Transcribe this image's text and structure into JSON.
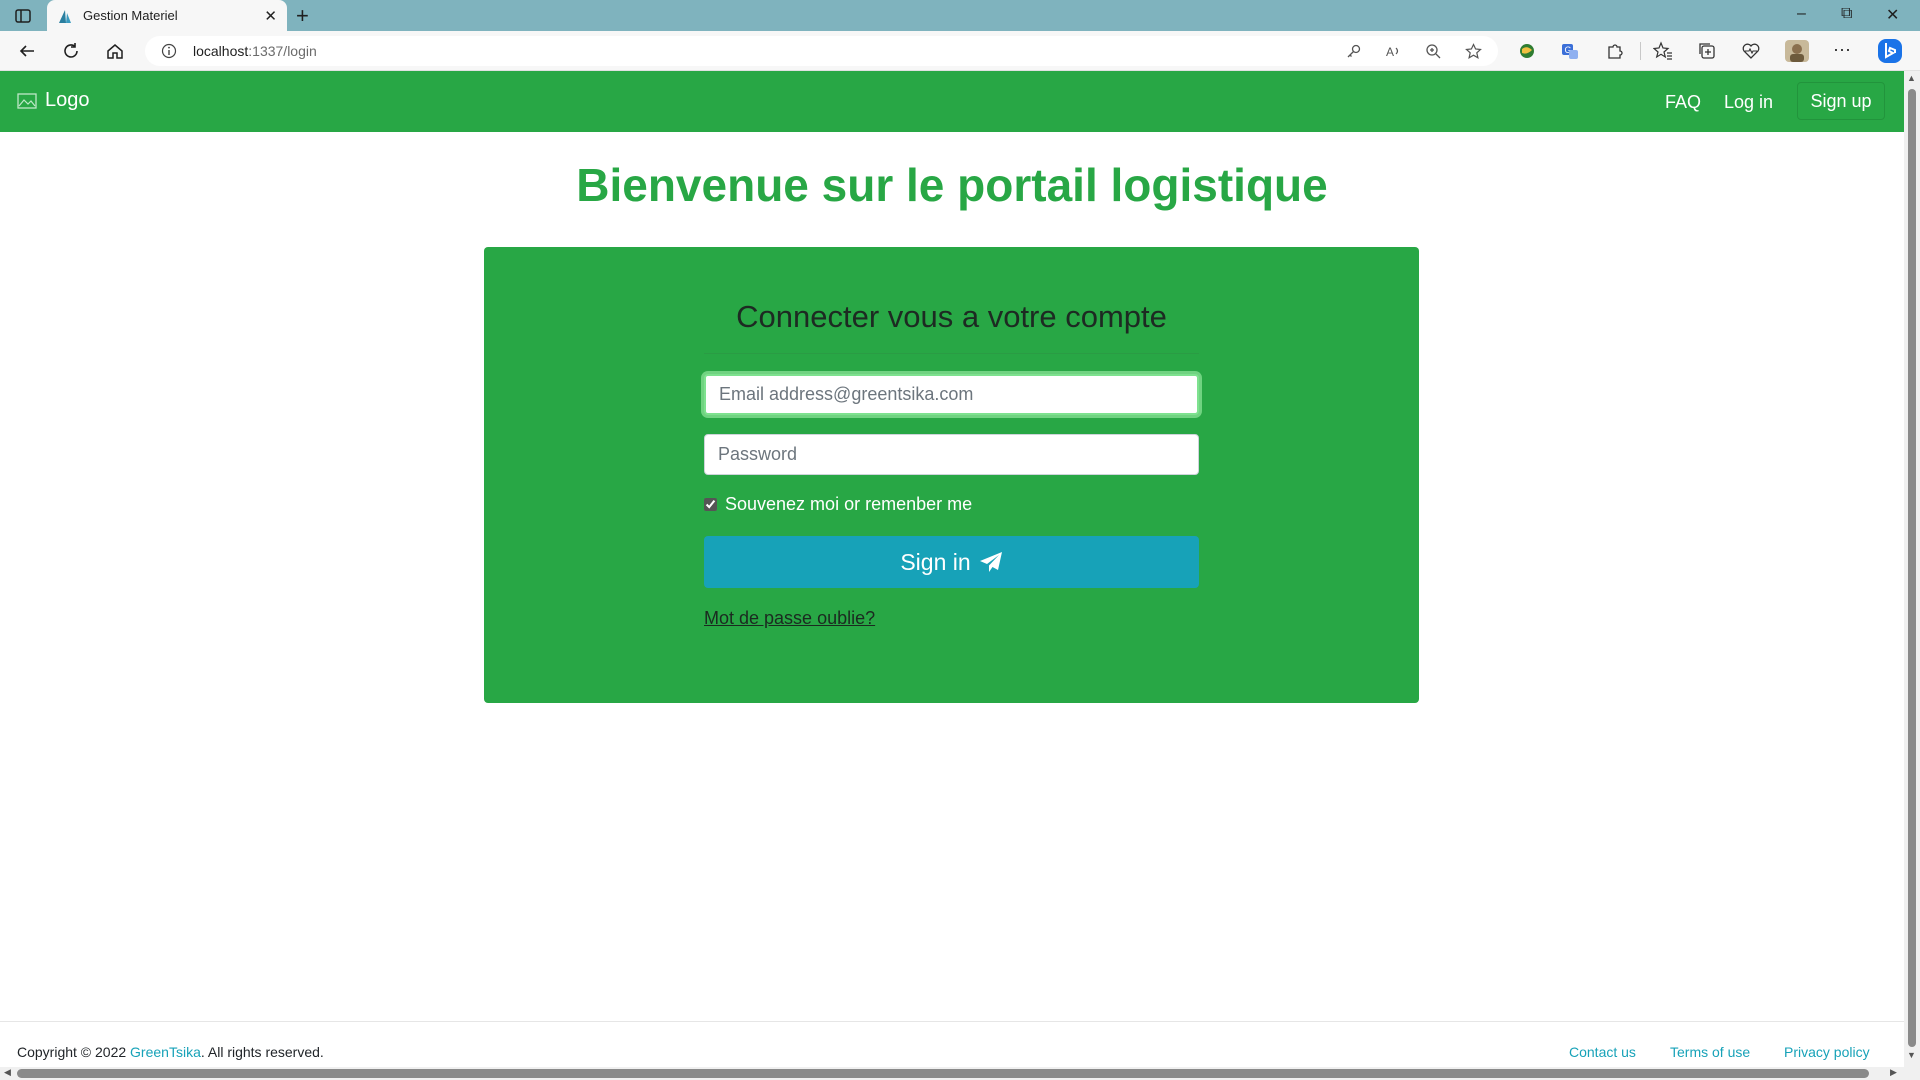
{
  "browser": {
    "tab_title": "Gestion Materiel",
    "tab_close": "✕",
    "new_tab": "+",
    "url_host": "localhost",
    "url_path": ":1337/login",
    "window_controls": {
      "minimize": "–",
      "restore": "⧉",
      "close": "✕"
    },
    "menu": "···"
  },
  "site": {
    "logo_text": "Logo",
    "nav": {
      "faq": "FAQ",
      "login": "Log in",
      "signup": "Sign up"
    },
    "title": "Bienvenue sur le portail logistique"
  },
  "login_card": {
    "heading": "Connecter vous a votre compte",
    "email_placeholder": "Email address@greentsika.com",
    "password_placeholder": "Password",
    "remember_label": "Souvenez moi or remenber me",
    "remember_checked": true,
    "signin_label": "Sign in",
    "forgot_link": "Mot de passe oublie?"
  },
  "footer": {
    "copyright_prefix": "Copyright © 2022 ",
    "brand": "GreenTsika",
    "copyright_suffix": ". All rights reserved.",
    "links": {
      "contact": "Contact us",
      "terms": "Terms of use",
      "privacy": "Privacy policy"
    }
  },
  "colors": {
    "brand_green": "#28a745",
    "info_blue": "#17a2b8",
    "tab_strip": "#7fb3be"
  }
}
